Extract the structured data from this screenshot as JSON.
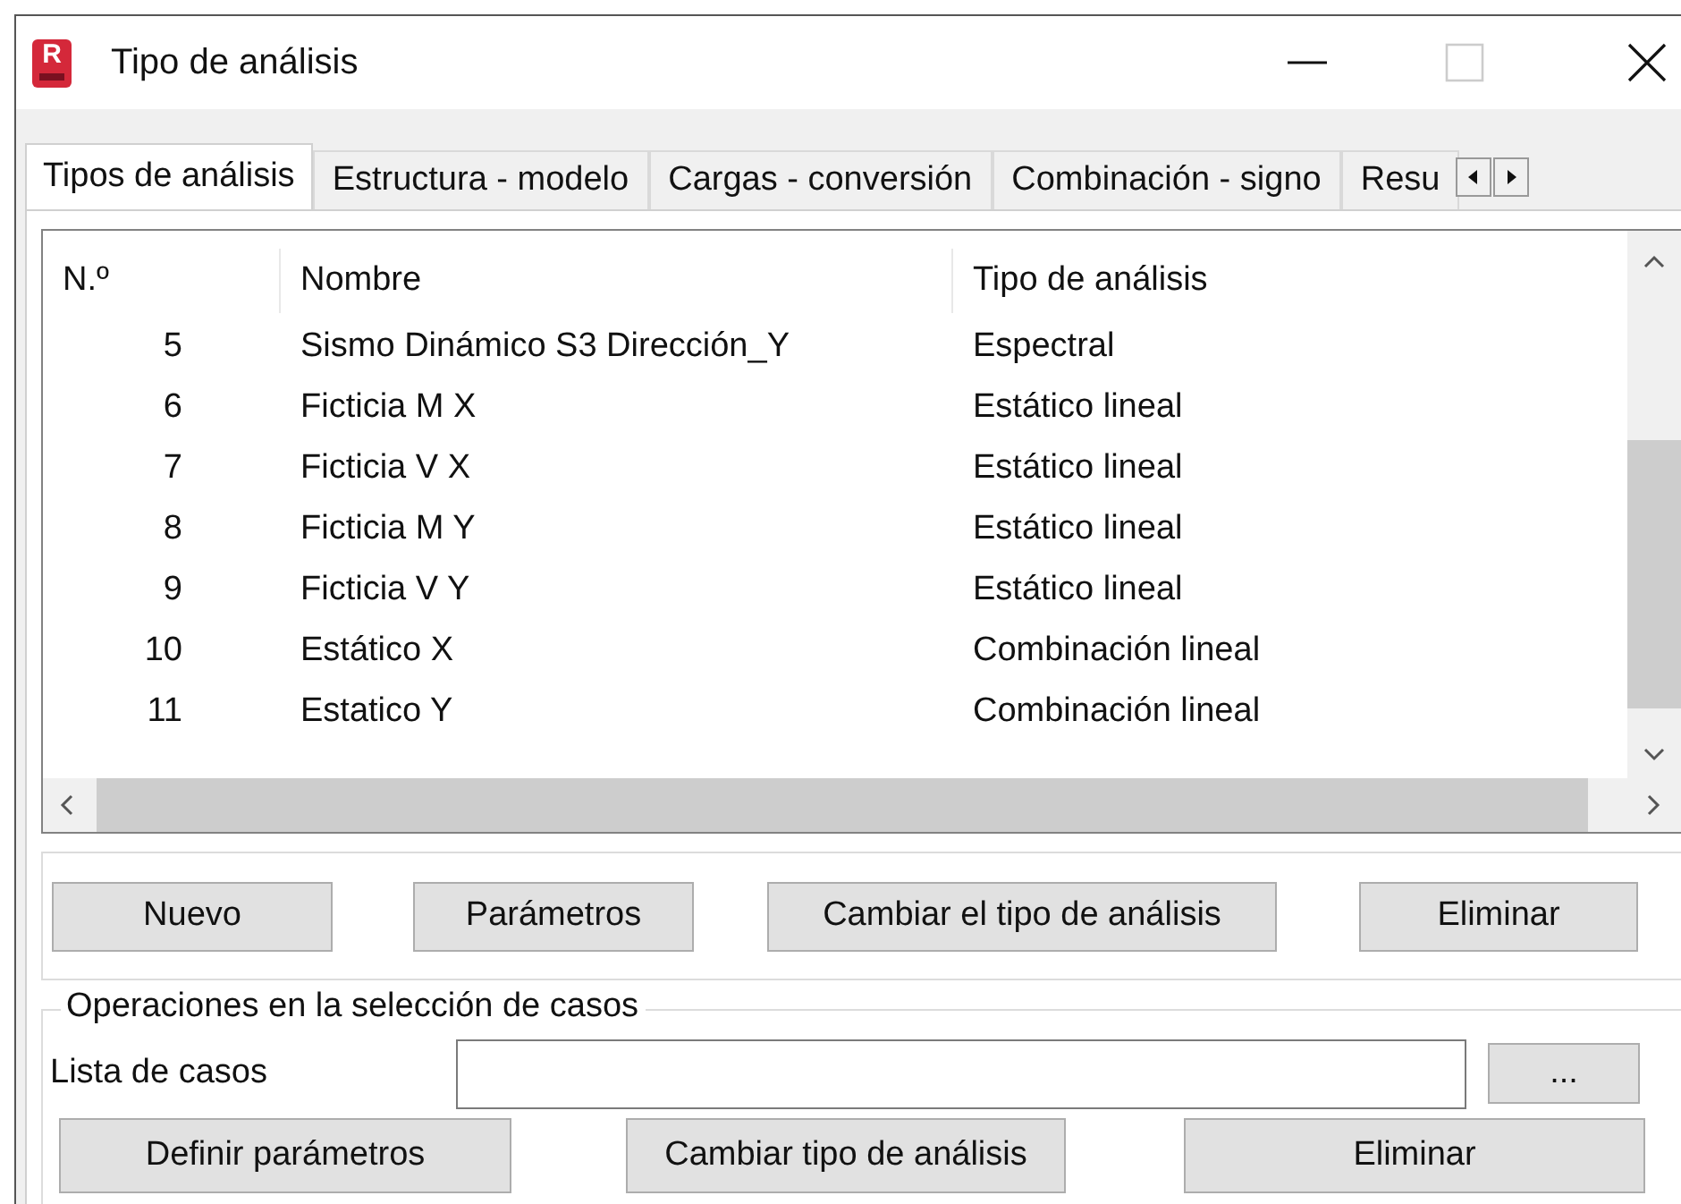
{
  "window": {
    "title": "Tipo de análisis",
    "app_icon_letter": "R"
  },
  "tabs": [
    {
      "label": "Tipos de análisis",
      "selected": true
    },
    {
      "label": "Estructura - modelo",
      "selected": false
    },
    {
      "label": "Cargas - conversión",
      "selected": false
    },
    {
      "label": "Combinación - signo",
      "selected": false
    },
    {
      "label": "Resu",
      "selected": false
    }
  ],
  "table": {
    "columns": [
      "N.º",
      "Nombre",
      "Tipo de análisis"
    ],
    "rows": [
      {
        "number": "5",
        "name": "Sismo Dinámico S3 Dirección_Y",
        "type": "Espectral"
      },
      {
        "number": "6",
        "name": "Ficticia M X",
        "type": "Estático lineal"
      },
      {
        "number": "7",
        "name": "Ficticia V X",
        "type": "Estático lineal"
      },
      {
        "number": "8",
        "name": "Ficticia M Y",
        "type": "Estático lineal"
      },
      {
        "number": "9",
        "name": "Ficticia V Y",
        "type": "Estático lineal"
      },
      {
        "number": "10",
        "name": "Estático X",
        "type": "Combinación lineal"
      },
      {
        "number": "11",
        "name": "Estatico Y",
        "type": "Combinación lineal"
      }
    ]
  },
  "buttons": [
    "Nuevo",
    "Parámetros",
    "Cambiar el tipo de análisis",
    "Eliminar"
  ],
  "selection_group": {
    "title": "Operaciones en la selección de casos",
    "list_label": "Lista de casos",
    "browse_button": "...",
    "buttons": [
      "Definir parámetros",
      "Cambiar tipo de análisis",
      "Eliminar"
    ]
  }
}
